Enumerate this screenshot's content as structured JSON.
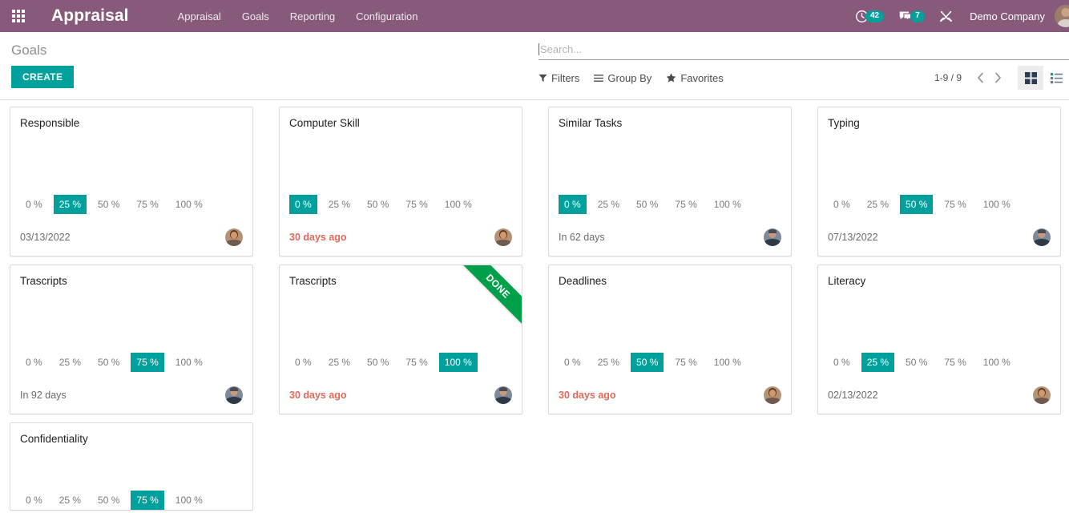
{
  "navbar": {
    "apps_icon": "apps-grid-icon",
    "brand": "Appraisal",
    "menu": [
      {
        "label": "Appraisal"
      },
      {
        "label": "Goals"
      },
      {
        "label": "Reporting"
      },
      {
        "label": "Configuration"
      }
    ],
    "activity": {
      "icon": "clock-icon",
      "count": "42"
    },
    "messages": {
      "icon": "comment-icon",
      "count": "7"
    },
    "tools_icon": "wrench-screwdriver-icon",
    "company": "Demo Company",
    "avatar": "user-avatar",
    "bg_color": "#875A7B"
  },
  "control_panel": {
    "title": "Goals",
    "create_label": "CREATE",
    "search": {
      "placeholder": "Search...",
      "value": ""
    },
    "filters_label": "Filters",
    "group_by_label": "Group By",
    "favorites_label": "Favorites",
    "pager": "1-9 / 9",
    "prev_icon": "chevron-left-icon",
    "next_icon": "chevron-right-icon",
    "view_kanban_icon": "kanban-view-icon",
    "view_list_icon": "list-view-icon",
    "active_view": "kanban",
    "accent_color": "#00A09D"
  },
  "kanban": {
    "percent_options": [
      "0 %",
      "25 %",
      "50 %",
      "75 %",
      "100 %"
    ],
    "selected_color": "#00A09D",
    "overdue_color": "#E06A5B",
    "ribbon_color": "#00A04A",
    "cards": [
      {
        "title": "Responsible",
        "selected_index": 1,
        "date": "03/13/2022",
        "overdue": false,
        "avatar": "type-a",
        "ribbon": null
      },
      {
        "title": "Computer Skill",
        "selected_index": 0,
        "date": "30 days ago",
        "overdue": true,
        "avatar": "type-a",
        "ribbon": null
      },
      {
        "title": "Similar Tasks",
        "selected_index": 0,
        "date": "In 62 days",
        "overdue": false,
        "avatar": "type-b",
        "ribbon": null
      },
      {
        "title": "Typing",
        "selected_index": 2,
        "date": "07/13/2022",
        "overdue": false,
        "avatar": "type-b",
        "ribbon": null
      },
      {
        "title": "Trascripts",
        "selected_index": 3,
        "date": "In 92 days",
        "overdue": false,
        "avatar": "type-b",
        "ribbon": null
      },
      {
        "title": "Trascripts",
        "selected_index": 4,
        "date": "30 days ago",
        "overdue": true,
        "avatar": "type-b",
        "ribbon": "DONE"
      },
      {
        "title": "Deadlines",
        "selected_index": 2,
        "date": "30 days ago",
        "overdue": true,
        "avatar": "type-a",
        "ribbon": null
      },
      {
        "title": "Literacy",
        "selected_index": 1,
        "date": "02/13/2022",
        "overdue": false,
        "avatar": "type-a",
        "ribbon": null
      },
      {
        "title": "Confidentiality",
        "selected_index": 3,
        "date": "",
        "overdue": false,
        "avatar": "type-a",
        "ribbon": null,
        "partial": true
      }
    ]
  }
}
